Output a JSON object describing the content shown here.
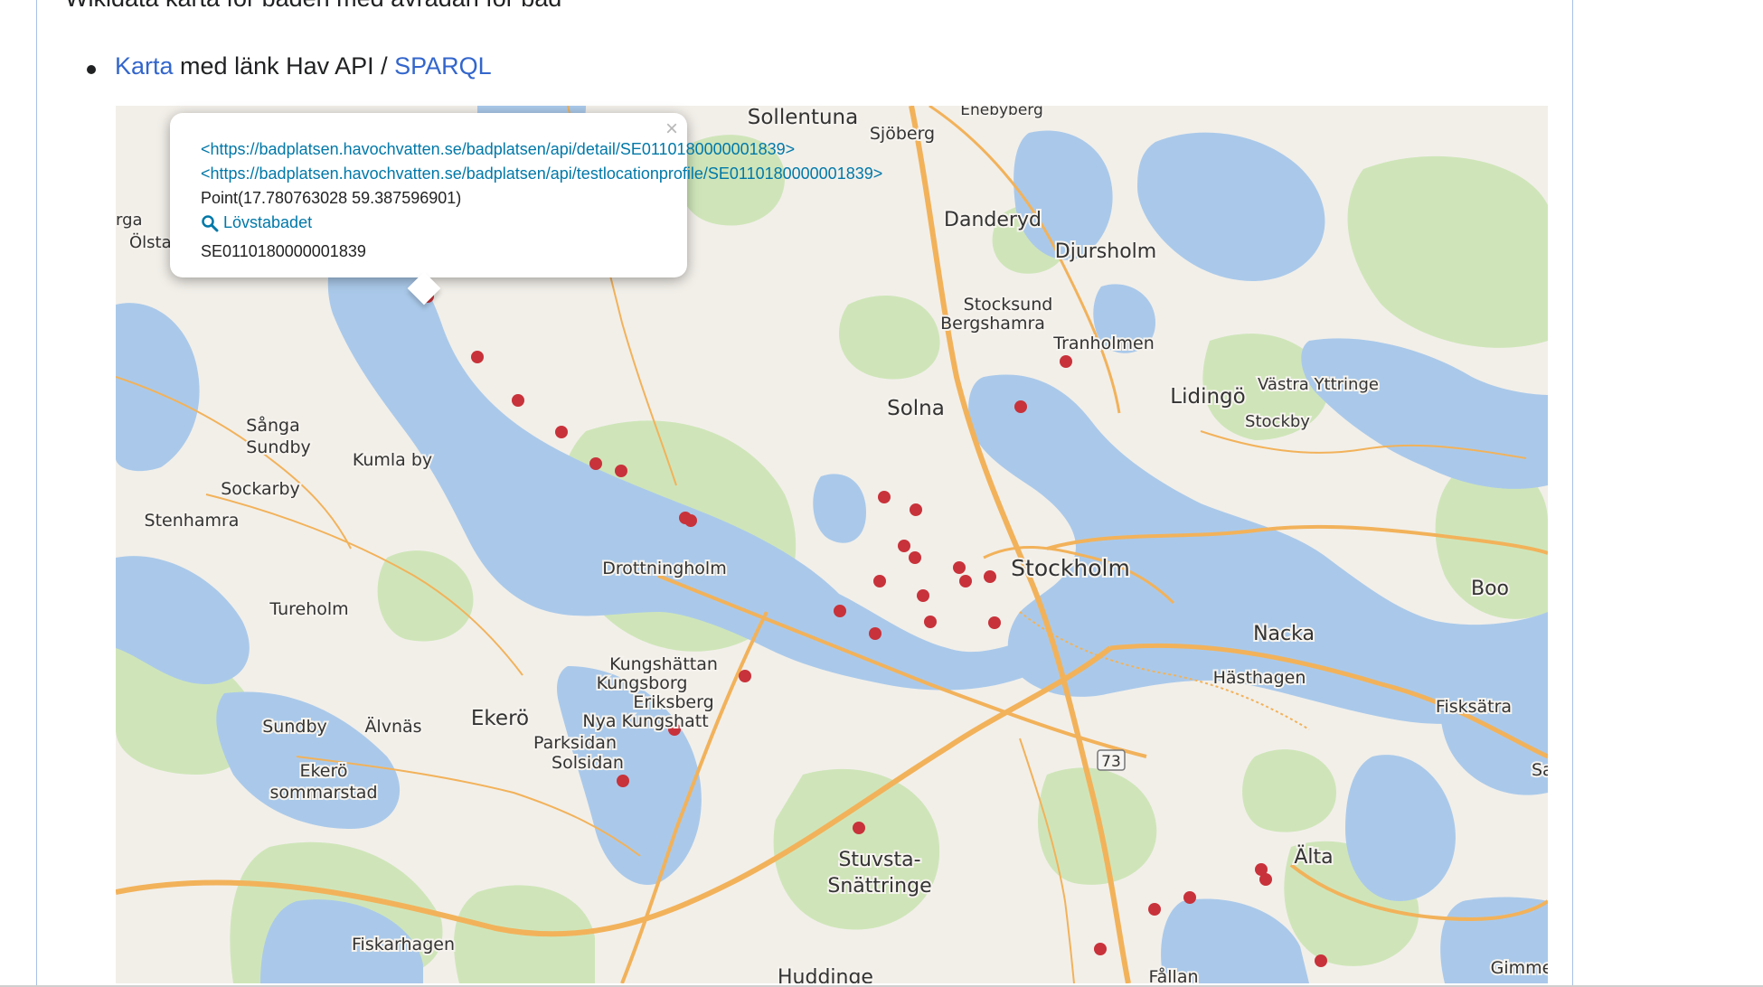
{
  "heading": {
    "text": "Wikidata karta för baden med avrådan för bad"
  },
  "bullet": {
    "link_karta": "Karta",
    "middle_text": " med länk Hav API / ",
    "link_sparql": "SPARQL"
  },
  "popup": {
    "close": "×",
    "detail_url": "<https://badplatsen.havochvatten.se/badplatsen/api/detail/SE0110180000001839>",
    "profile_url": "<https://badplatsen.havochvatten.se/badplatsen/api/testlocationprofile/SE0110180000001839>",
    "point": "Point(17.780763028 59.387596901)",
    "name": "Lövstabadet",
    "id": "SE0110180000001839"
  },
  "map": {
    "search_icon": "magnifier-icon",
    "marker_color": "#c8323a",
    "water_color": "#aac9ea",
    "land_color": "#f2efe9",
    "forest_color": "#cfe5b9",
    "road_color": "#f2b25a",
    "places": [
      "Sollentuna",
      "Sjöberg",
      "Enebyberg",
      "Danderyd",
      "Djursholm",
      "Stocksund",
      "Bergshamra",
      "Tranholmen",
      "Lidingö",
      "Västra Yttringe",
      "Stockby",
      "Solna",
      "rga",
      "Ölsta",
      "Sånga",
      "Sundby",
      "Kumla by",
      "Sockarby",
      "Stenhamra",
      "Drottningholm",
      "Stockholm",
      "Boo",
      "Tureholm",
      "Nacka",
      "Kungshättan",
      "Kungsborg",
      "Eriksberg",
      "Hästhagen",
      "Fisksätra",
      "Sundby",
      "Älvnäs",
      "Ekerö",
      "Nya Kungshatt",
      "Parksidan",
      "Solsidan",
      "Ekerö",
      "sommarstad",
      "73",
      "Sa",
      "Stuvsta-",
      "Snättringe",
      "Älta",
      "Fiskarhagen",
      "Huddinge",
      "Fållan",
      "Gimme"
    ]
  }
}
